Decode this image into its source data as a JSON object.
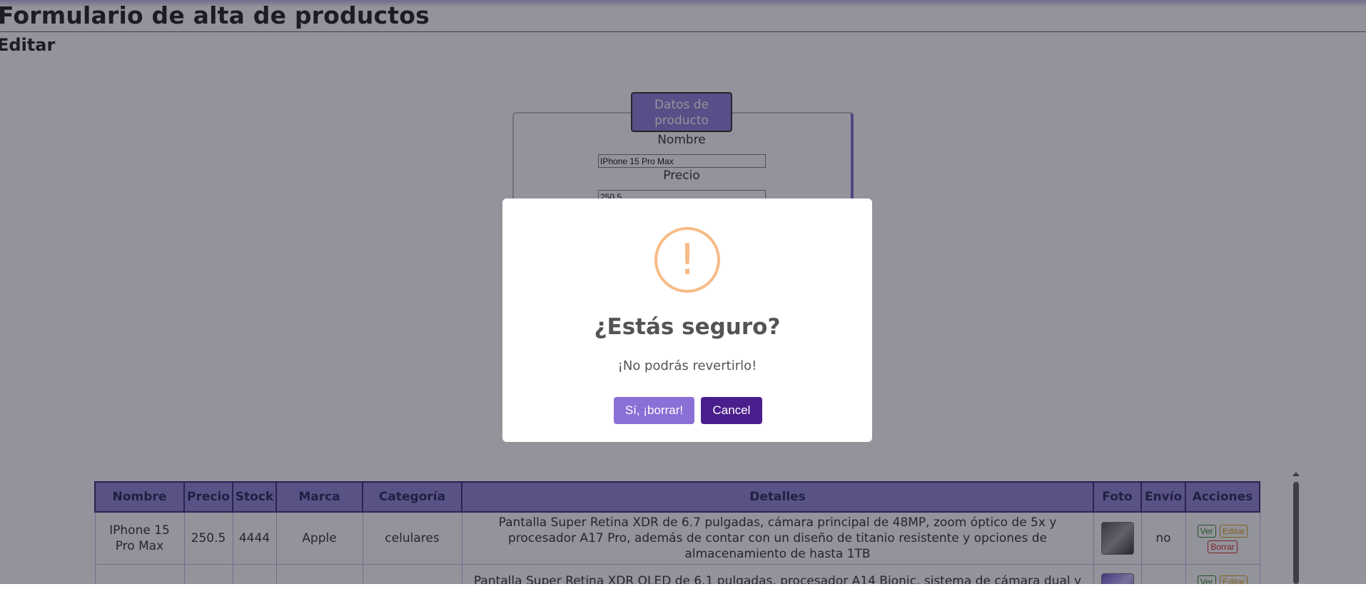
{
  "page": {
    "title": "Formulario de alta de productos",
    "subtitle": "Editar"
  },
  "form": {
    "legend": "Datos de producto",
    "fields": [
      {
        "label": "Nombre",
        "value": "IPhone 15 Pro Max"
      },
      {
        "label": "Precio",
        "value": "250.5"
      }
    ]
  },
  "table": {
    "headers": [
      "Nombre",
      "Precio",
      "Stock",
      "Marca",
      "Categoría",
      "Detalles",
      "Foto",
      "Envío",
      "Acciones"
    ],
    "rows": [
      {
        "nombre": "IPhone 15 Pro Max",
        "precio": "250.5",
        "stock": "4444",
        "marca": "Apple",
        "categoria": "celulares",
        "detalles": "Pantalla Super Retina XDR de 6.7 pulgadas, cámara principal de 48MP, zoom óptico de 5x y procesador A17 Pro, además de contar con un diseño de titanio resistente y opciones de almacenamiento de hasta 1TB",
        "envio": "no"
      },
      {
        "nombre": "",
        "precio": "",
        "stock": "",
        "marca": "",
        "categoria": "",
        "detalles": "Pantalla Super Retina XDR OLED de 6.1 pulgadas, procesador A14 Bionic, sistema de cámara dual y resistencia al",
        "envio": ""
      }
    ],
    "actions": {
      "view": "Ver",
      "edit": "Editar",
      "delete": "Borrar"
    }
  },
  "modal": {
    "icon": "warning-icon",
    "icon_glyph": "!",
    "title": "¿Estás seguro?",
    "text": "¡No podrás revertirlo!",
    "confirm_label": "Sí, ¡borrar!",
    "cancel_label": "Cancel"
  },
  "colors": {
    "header_bg": "#8a7fd2",
    "confirm_button": "#8a6fd6",
    "cancel_button": "#4a1e8c",
    "warning_icon": "#f8bb86"
  }
}
